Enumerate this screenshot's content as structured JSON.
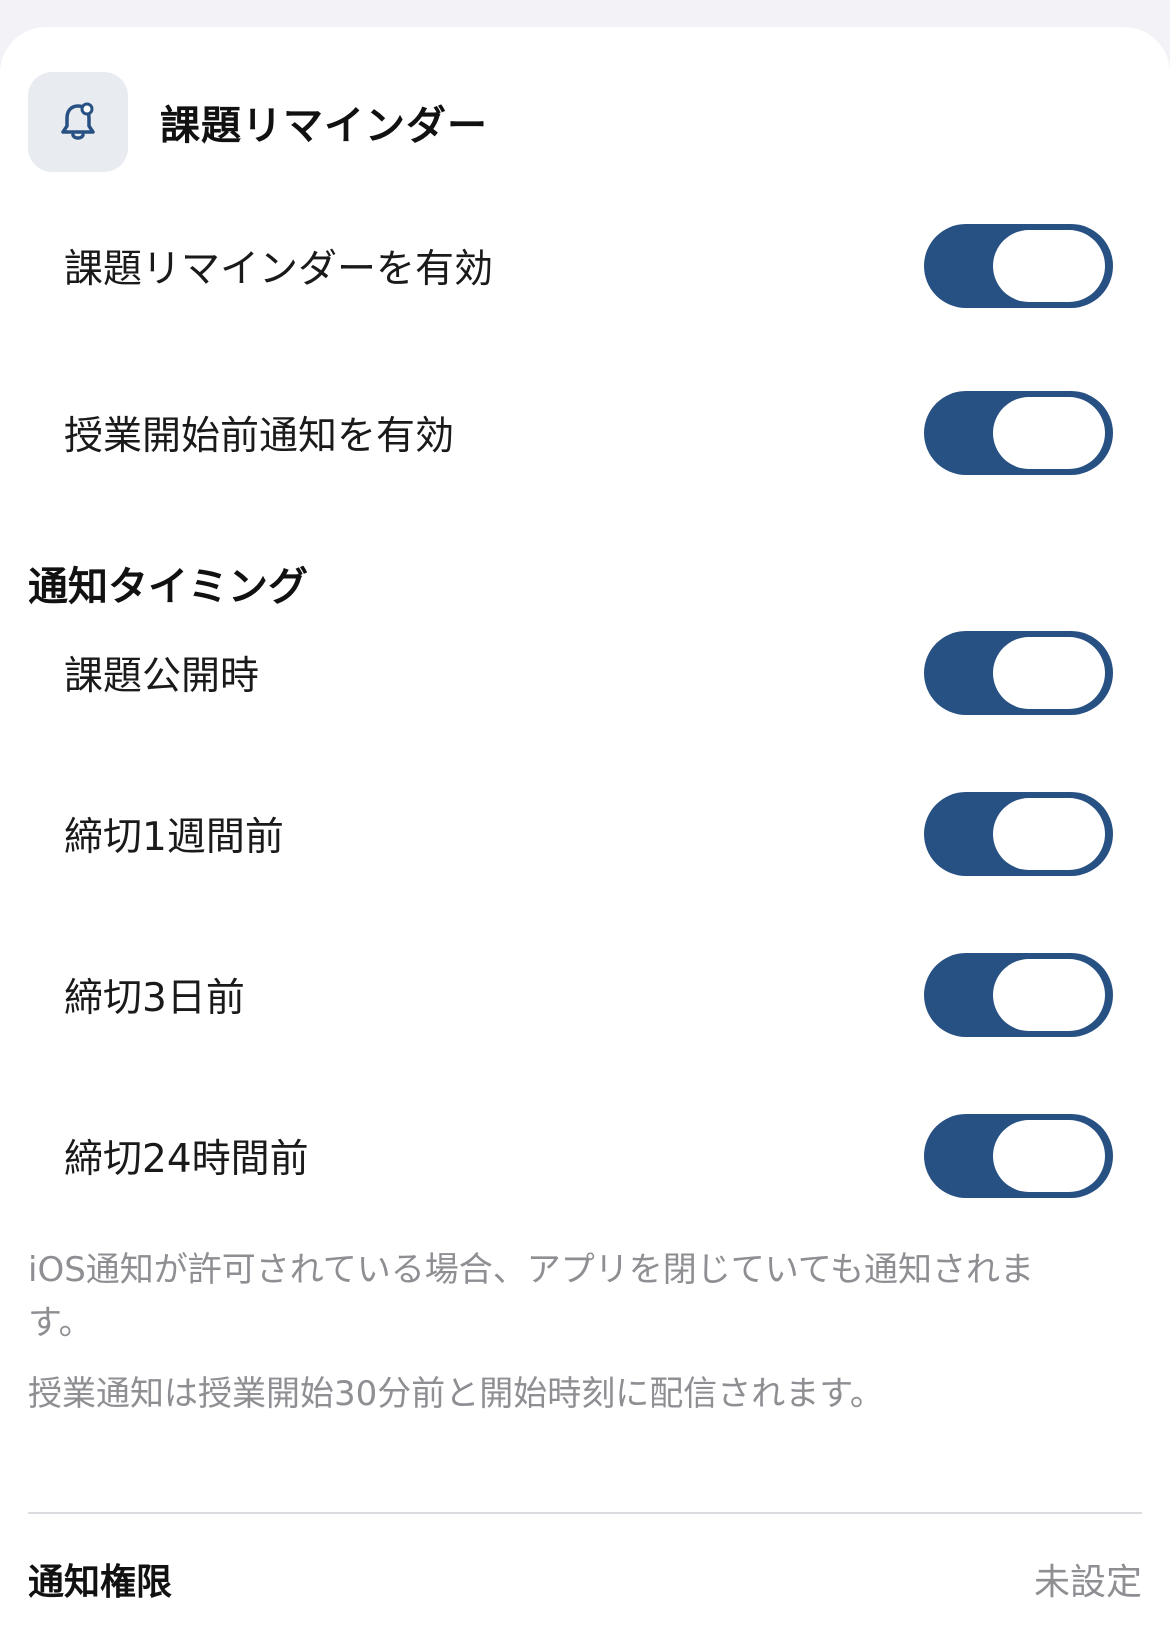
{
  "header": {
    "title": "課題リマインダー",
    "icon": "bell-icon"
  },
  "reminders": {
    "items": [
      {
        "label": "課題リマインダーを有効",
        "on": true
      },
      {
        "label": "授業開始前通知を有効",
        "on": true
      }
    ]
  },
  "timing": {
    "title": "通知タイミング",
    "items": [
      {
        "label": "課題公開時",
        "on": true
      },
      {
        "label": "締切1週間前",
        "on": true
      },
      {
        "label": "締切3日前",
        "on": true
      },
      {
        "label": "締切24時間前",
        "on": true
      }
    ]
  },
  "notes": {
    "ios": "iOS通知が許可されている場合、アプリを閉じていても通知されます。",
    "class": "授業通知は授業開始30分前と開始時刻に配信されます。"
  },
  "permission": {
    "label": "通知権限",
    "value": "未設定"
  },
  "colors": {
    "accent": "#275083",
    "background": "#f2f2f7",
    "card": "#ffffff",
    "secondary_text": "#8e8e93",
    "icon_bg": "#e8ecf1"
  }
}
